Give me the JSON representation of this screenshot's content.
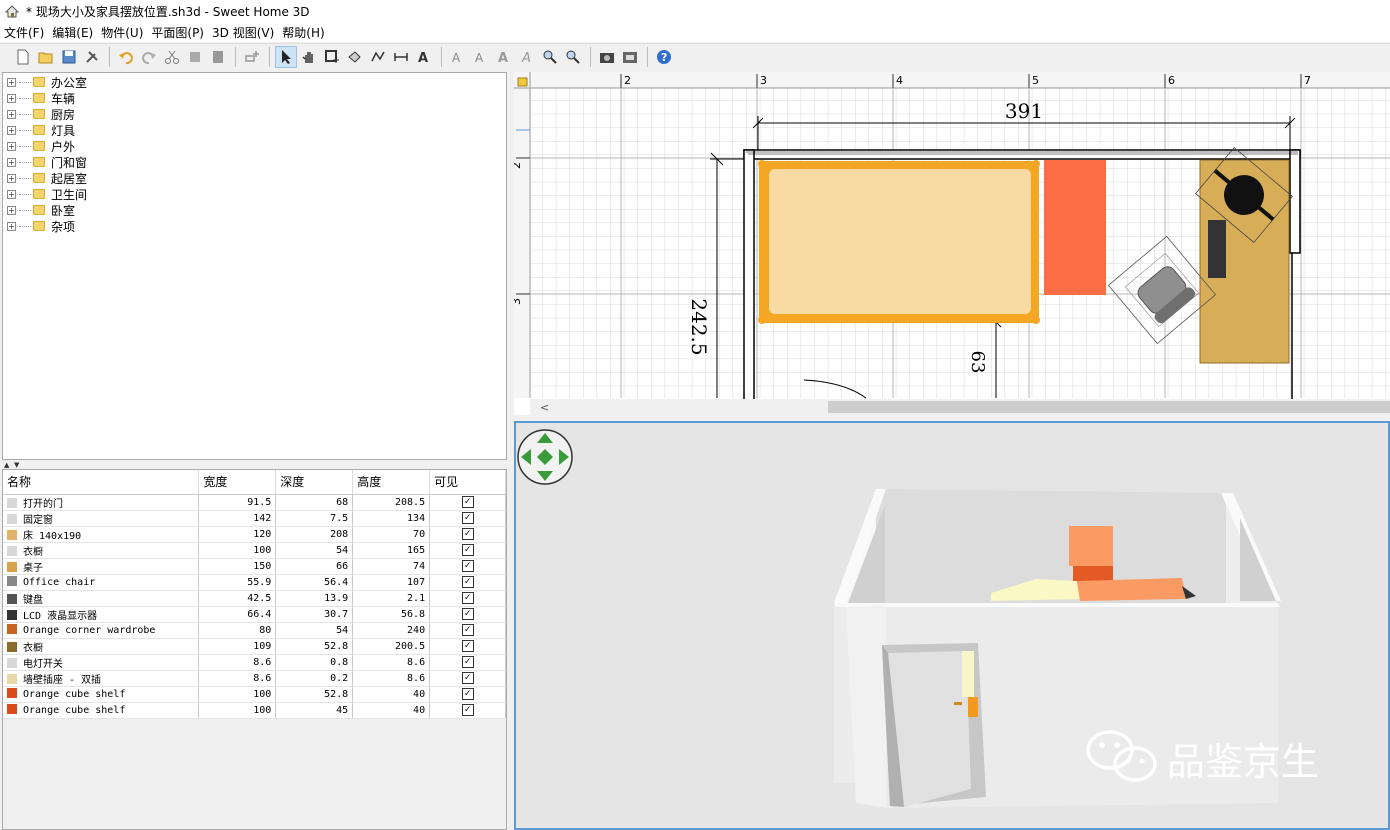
{
  "window": {
    "title": "* 现场大小及家具摆放位置.sh3d - Sweet Home 3D"
  },
  "menu": [
    "文件(F)",
    "编辑(E)",
    "物件(U)",
    "平面图(P)",
    "3D 视图(V)",
    "帮助(H)"
  ],
  "catalog": [
    "办公室",
    "车辆",
    "厨房",
    "灯具",
    "户外",
    "门和窗",
    "起居室",
    "卫生间",
    "卧室",
    "杂项"
  ],
  "furniture_table": {
    "headers": [
      "名称",
      "宽度",
      "深度",
      "高度",
      "可见"
    ],
    "rows": [
      {
        "name": "打开的门",
        "w": "91.5",
        "d": "68",
        "h": "208.5",
        "icon": "door-icon",
        "color": "#d8d8d8"
      },
      {
        "name": "固定窗",
        "w": "142",
        "d": "7.5",
        "h": "134",
        "icon": "window-icon",
        "color": "#d8d8d8"
      },
      {
        "name": "床 140x190",
        "w": "120",
        "d": "208",
        "h": "70",
        "icon": "bed-icon",
        "color": "#e0b26a"
      },
      {
        "name": "衣橱",
        "w": "100",
        "d": "54",
        "h": "165",
        "icon": "wardrobe-icon",
        "color": "#d8d8d8"
      },
      {
        "name": "桌子",
        "w": "150",
        "d": "66",
        "h": "74",
        "icon": "table-icon",
        "color": "#d9a34a"
      },
      {
        "name": "Office chair",
        "w": "55.9",
        "d": "56.4",
        "h": "107",
        "icon": "chair-icon",
        "color": "#888888"
      },
      {
        "name": "键盘",
        "w": "42.5",
        "d": "13.9",
        "h": "2.1",
        "icon": "keyboard-icon",
        "color": "#555555"
      },
      {
        "name": "LCD 液晶显示器",
        "w": "66.4",
        "d": "30.7",
        "h": "56.8",
        "icon": "monitor-icon",
        "color": "#333333"
      },
      {
        "name": "Orange corner wardrobe",
        "w": "80",
        "d": "54",
        "h": "240",
        "icon": "corner-wardrobe-icon",
        "color": "#c8641e"
      },
      {
        "name": "衣橱",
        "w": "109",
        "d": "52.8",
        "h": "200.5",
        "icon": "wardrobe-icon",
        "color": "#8a6b2a"
      },
      {
        "name": "电灯开关",
        "w": "8.6",
        "d": "0.8",
        "h": "8.6",
        "icon": "switch-icon",
        "color": "#d8d8d8"
      },
      {
        "name": "墙壁插座 - 双插",
        "w": "8.6",
        "d": "0.2",
        "h": "8.6",
        "icon": "socket-icon",
        "color": "#e8d8a8"
      },
      {
        "name": "Orange cube shelf",
        "w": "100",
        "d": "52.8",
        "h": "40",
        "icon": "shelf-icon",
        "color": "#d94b1a"
      },
      {
        "name": "Orange cube shelf",
        "w": "100",
        "d": "45",
        "h": "40",
        "icon": "shelf-icon",
        "color": "#d94b1a"
      }
    ]
  },
  "plan": {
    "ruler_x": [
      "2",
      "3",
      "4",
      "5",
      "6",
      "7"
    ],
    "ruler_y": [
      "2",
      "3"
    ],
    "dim_width": "391",
    "dim_depth": "242.5",
    "dim_small": "63"
  },
  "watermark": {
    "text": "品鉴京生"
  }
}
